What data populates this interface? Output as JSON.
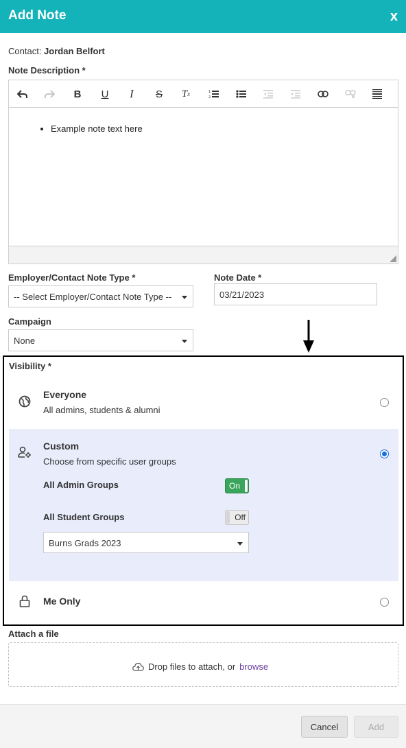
{
  "header": {
    "title": "Add Note",
    "close_label": "x"
  },
  "contact": {
    "prefix": "Contact:",
    "name": "Jordan Belfort"
  },
  "note_description": {
    "label": "Note Description *",
    "toolbar_icons": [
      "undo-icon",
      "redo-icon",
      "bold-icon",
      "underline-icon",
      "italic-icon",
      "strikethrough-icon",
      "remove-format-icon",
      "numbered-list-icon",
      "bullet-list-icon",
      "outdent-icon",
      "indent-icon",
      "link-icon",
      "unlink-icon",
      "horizontal-rule-icon"
    ],
    "content_items": [
      "Example note text here"
    ]
  },
  "note_type": {
    "label": "Employer/Contact Note Type *",
    "value": "-- Select Employer/Contact Note Type --"
  },
  "note_date": {
    "label": "Note Date *",
    "value": "03/21/2023"
  },
  "campaign": {
    "label": "Campaign",
    "value": "None"
  },
  "visibility": {
    "label": "Visibility *",
    "options": [
      {
        "title": "Everyone",
        "description": "All admins, students & alumni",
        "icon": "globe-icon",
        "selected": false
      },
      {
        "title": "Custom",
        "description": "Choose from specific user groups",
        "icon": "user-settings-icon",
        "selected": true
      },
      {
        "title": "Me Only",
        "description": "",
        "icon": "lock-icon",
        "selected": false
      }
    ],
    "admin_groups": {
      "label": "All Admin Groups",
      "state": "On"
    },
    "student_groups": {
      "label": "All Student Groups",
      "state": "Off"
    },
    "group_select": {
      "value": "Burns Grads 2023"
    }
  },
  "attach": {
    "label": "Attach a file",
    "text": "Drop files to attach, or",
    "browse": "browse"
  },
  "footer": {
    "cancel": "Cancel",
    "add": "Add"
  },
  "colors": {
    "header": "#14b2b9",
    "selected_bg": "#e8ecfb",
    "radio": "#1a6fe3",
    "toggle_on": "#3ba55c",
    "browse_link": "#6b3fa0"
  }
}
